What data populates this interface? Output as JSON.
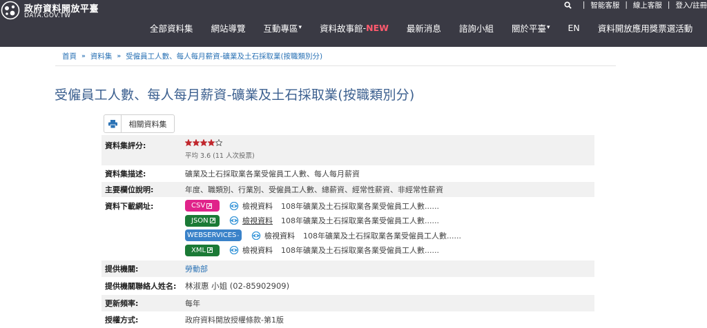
{
  "header": {
    "logo_title": "政府資料開放平臺",
    "logo_subtitle": "DATA.GOV.TW",
    "util_links": [
      "智能客服",
      "線上客服",
      "登入/註冊"
    ],
    "nav": [
      {
        "label": "全部資料集"
      },
      {
        "label": "網站導覽"
      },
      {
        "label": "互動專區",
        "caret": "▾"
      },
      {
        "label": "資料故事館",
        "caret": "-",
        "badge": "NEW"
      },
      {
        "label": "最新消息"
      },
      {
        "label": "諮詢小組"
      },
      {
        "label": "關於平臺",
        "caret": "▾"
      },
      {
        "label": "EN"
      },
      {
        "label": "資料開放應用獎票選活動"
      }
    ]
  },
  "breadcrumb": [
    "首頁",
    "資料集",
    "受僱員工人數、每人每月薪資-礦業及土石採取業(按職類別分)"
  ],
  "page_title": "受僱員工人數、每人每月薪資-礦業及土石採取業(按職類別分)",
  "buttons": {
    "related": "相關資料集"
  },
  "meta": {
    "rating_label": "資料集評分:",
    "rating_stars": 4,
    "rating_max": 5,
    "rating_avg": "平均 3.6 (11 人次投票)",
    "desc_label": "資料集描述:",
    "desc_value": "礦業及土石採取業各業受僱員工人數、每人每月薪資",
    "fields_label": "主要欄位說明:",
    "fields_value": "年度、職類別、行業別、受僱員工人數、總薪資、經常性薪資、非經常性薪資",
    "download_label": "資料下載網址:",
    "downloads": [
      {
        "format": "CSV",
        "view": "檢視資料",
        "name": "108年礦業及土石採取業各業受僱員工人數......"
      },
      {
        "format": "JSON",
        "view": "檢視資料",
        "name": "108年礦業及土石採取業各業受僱員工人數......"
      },
      {
        "format": "WEBSERVICES",
        "view": "檢視資料",
        "name": "108年礦業及土石採取業各業受僱員工人數......"
      },
      {
        "format": "XML",
        "view": "檢視資料",
        "name": "108年礦業及土石採取業各業受僱員工人數......"
      }
    ],
    "agency_label": "提供機關:",
    "agency_value": "勞動部",
    "contact_label": "提供機關聯絡人姓名:",
    "contact_value": "林淑惠 小姐 (02-85902909)",
    "freq_label": "更新頻率:",
    "freq_value": "每年",
    "license_label": "授權方式:",
    "license_value": "政府資料開放授權條款-第1版"
  },
  "colors": {
    "header_bg": "#3a3a44",
    "title": "#3b5f8f",
    "link": "#2a72b5",
    "csv": "#e0238a",
    "json": "#1b7a36",
    "webservices": "#3a82c9",
    "xml": "#1b7a36",
    "star": "#c0272d",
    "new_badge": "#ff5a6e"
  }
}
